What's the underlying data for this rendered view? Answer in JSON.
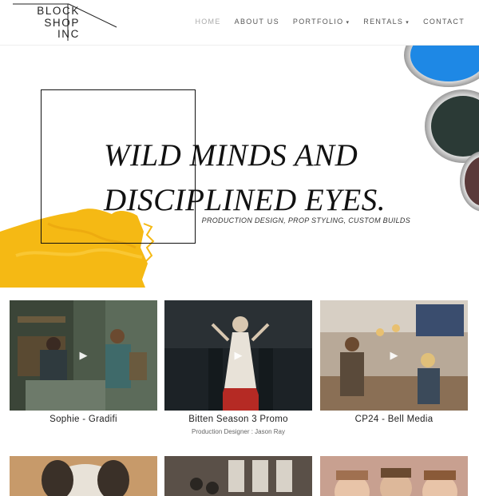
{
  "header": {
    "logo_lines": [
      "BLOCK",
      "SHOP",
      "INC"
    ],
    "nav": [
      {
        "label": "HOME",
        "active": true,
        "dropdown": false
      },
      {
        "label": "ABOUT US",
        "active": false,
        "dropdown": false
      },
      {
        "label": "PORTFOLIO",
        "active": false,
        "dropdown": true
      },
      {
        "label": "RENTALS",
        "active": false,
        "dropdown": true
      },
      {
        "label": "CONTACT",
        "active": false,
        "dropdown": false
      }
    ]
  },
  "hero": {
    "headline_line1": "WILD MINDS AND",
    "headline_line2": "DISCIPLINED EYES.",
    "tagline": "PRODUCTION DESIGN, PROP STYLING, CUSTOM BUILDS"
  },
  "portfolio": [
    {
      "title": "Sophie - Gradifi",
      "subtitle": ""
    },
    {
      "title": "Bitten Season 3 Promo",
      "subtitle": "Production Designer : Jason Ray"
    },
    {
      "title": "CP24 - Bell Media",
      "subtitle": ""
    }
  ],
  "colors": {
    "paint_blue": "#1e88e5",
    "paint_yellow": "#f5b914",
    "paint_dark": "#2b3a36"
  },
  "icons": {
    "play": "▶",
    "caret": "▾"
  }
}
